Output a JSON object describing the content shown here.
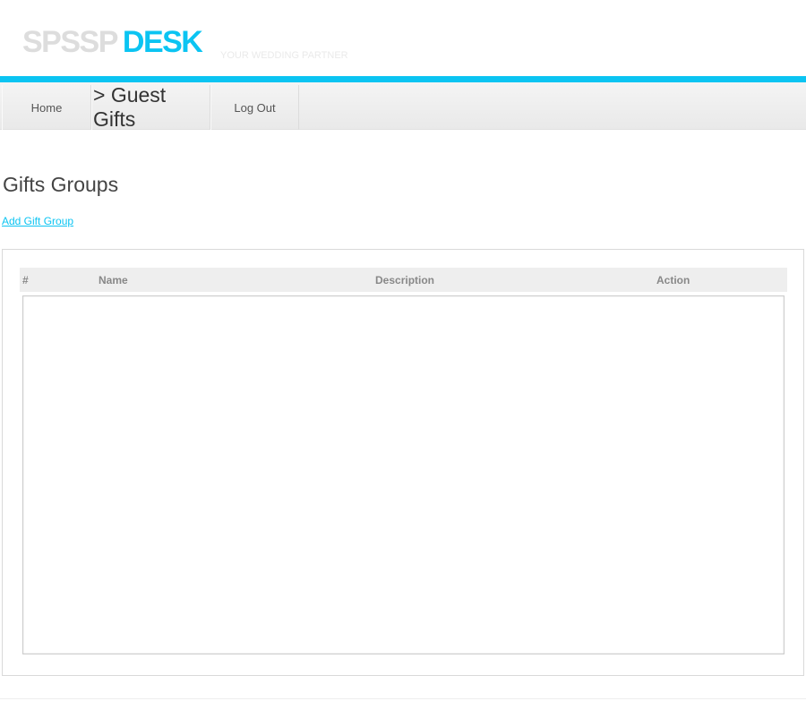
{
  "brand": {
    "name_part_1": "SPSSP",
    "name_part_2": "DESK",
    "tagline": "YOUR WEDDING PARTNER",
    "accent_color": "#0bc4f2"
  },
  "nav": {
    "home_label": "Home",
    "current_label": "> Guest Gifts",
    "logout_label": "Log Out"
  },
  "main": {
    "title": "Gifts Groups",
    "add_link_label": "Add Gift Group"
  },
  "table": {
    "columns": [
      "#",
      "Name",
      "Description",
      "Action"
    ],
    "rows": []
  }
}
